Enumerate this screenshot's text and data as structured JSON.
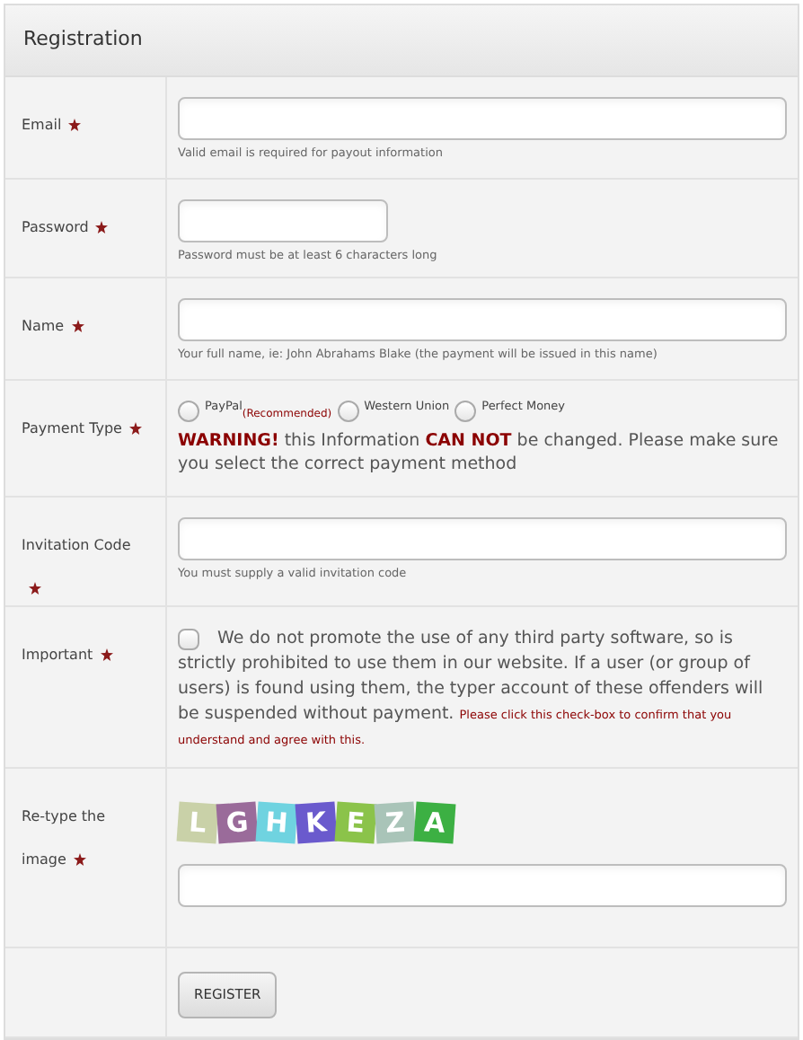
{
  "panel": {
    "title": "Registration"
  },
  "rows": [
    {
      "kind": "field",
      "label": "Email",
      "required": true,
      "hint": "Valid email is required for payout information"
    },
    {
      "kind": "short_field",
      "label": "Password",
      "required": true,
      "hint": "Password must be at least 6 characters long"
    },
    {
      "kind": "field",
      "label": "Name",
      "required": true,
      "hint": "Your full name, ie: John Abrahams Blake (the payment will be issued in this name)"
    },
    {
      "kind": "radios",
      "label": "Payment Type",
      "required": true,
      "options": [
        {
          "label": "PayPal",
          "note": "(Recommended)",
          "selected": false
        },
        {
          "label": "Western Union",
          "selected": false
        },
        {
          "label": "Perfect Money",
          "selected": false
        }
      ],
      "warning": "**WARNING!** this Information **CAN NOT** be changed. Please make sure you select the correct payment method"
    },
    {
      "kind": "field",
      "label": "Invitation Code",
      "required": true,
      "hint": "You must supply a valid invitation code"
    },
    {
      "kind": "checkbox",
      "label": "Important",
      "required": true,
      "checked": false,
      "text": "We do not promote the use of any third party software, so is strictly prohibited to use them in our website. If a user (or group of users) is found using them, the typer account of these offenders will be suspended without payment.",
      "note": "Please click this check-box to confirm that you understand and agree with this."
    },
    {
      "kind": "captcha",
      "label": "Re-type the image",
      "required": true,
      "letters": [
        {
          "char": "L",
          "color": "#c9d1a8"
        },
        {
          "char": "G",
          "color": "#9a6b9a"
        },
        {
          "char": "H",
          "color": "#6fd3e0"
        },
        {
          "char": "K",
          "color": "#6a5acd"
        },
        {
          "char": "E",
          "color": "#8bc34a"
        },
        {
          "char": "Z",
          "color": "#a9c4b8"
        },
        {
          "char": "A",
          "color": "#3cb043"
        }
      ]
    },
    {
      "kind": "submit",
      "button": "REGISTER"
    }
  ]
}
